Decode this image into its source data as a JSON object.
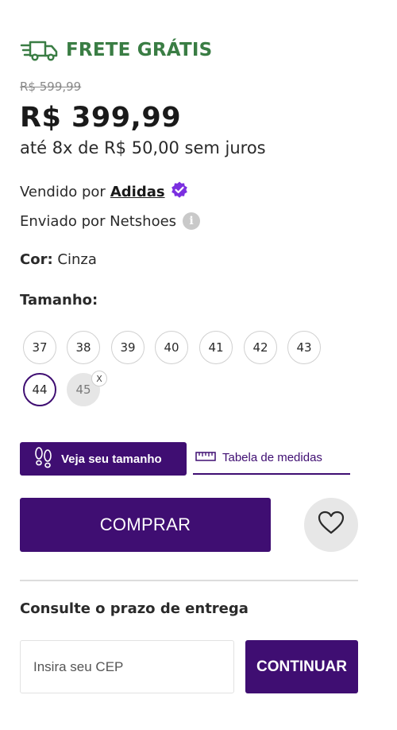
{
  "shipping": {
    "label": "FRETE GRÁTIS",
    "icon": "truck-icon",
    "color": "#3a7d44"
  },
  "pricing": {
    "old_price": "R$ 599,99",
    "price": "R$ 399,99",
    "installments": "até 8x de R$ 50,00 sem juros"
  },
  "seller": {
    "prefix": "Vendido por",
    "name": "Adidas",
    "badge_icon": "verified-badge-icon",
    "badge_color": "#7b2fe0"
  },
  "shipper": {
    "text": "Enviado por Netshoes",
    "icon": "info-icon"
  },
  "color": {
    "label": "Cor:",
    "value": "Cinza"
  },
  "sizes": {
    "title": "Tamanho:",
    "options": [
      "37",
      "38",
      "39",
      "40",
      "41",
      "42",
      "43",
      "44",
      "45"
    ],
    "selected": "44",
    "unavailable": [
      "45"
    ],
    "unavailable_mark": "X"
  },
  "size_guide": {
    "find_size_label": "Veja seu tamanho",
    "find_size_icon": "footprints-icon",
    "table_label": "Tabela de medidas",
    "table_icon": "ruler-icon"
  },
  "actions": {
    "buy_label": "COMPRAR",
    "wishlist_icon": "heart-icon"
  },
  "delivery": {
    "title": "Consulte o prazo de entrega",
    "cep_placeholder": "Insira seu CEP",
    "cep_value": "",
    "continue_label": "CONTINUAR"
  },
  "theme": {
    "primary": "#3f0e72"
  }
}
